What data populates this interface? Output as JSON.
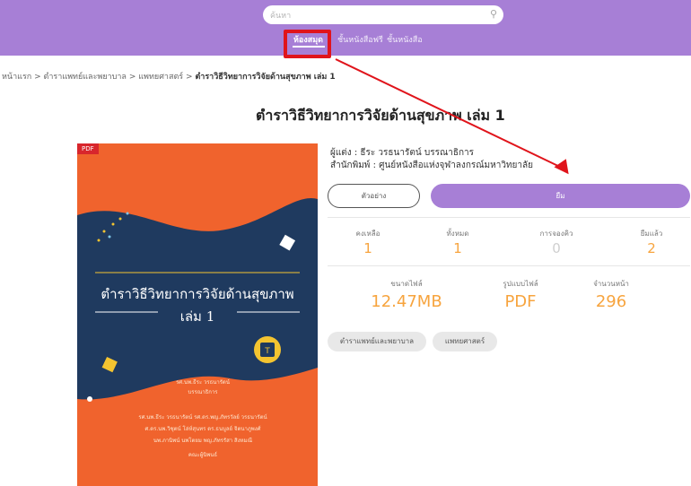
{
  "header": {
    "search_placeholder": "ค้นหา",
    "nav": {
      "library": "ห้องสมุด",
      "free_shelf": "ชั้นหนังสือฟรี",
      "bookshelf": "ชั้นหนังสือ"
    }
  },
  "breadcrumb": {
    "home": "หน้าแรก",
    "sep": ">",
    "cat1": "ตำราแพทย์และพยาบาล",
    "cat2": "แพทยศาสตร์",
    "current": "ตำราวิธีวิทยาการวิจัยด้านสุขภาพ เล่ม 1"
  },
  "book": {
    "title": "ตำราวิธีวิทยาการวิจัยด้านสุขภาพ เล่ม 1",
    "author": "ผู้แต่ง : ธีระ วรธนารัตน์ บรรณาธิการ",
    "publisher": "สำนักพิมพ์ : ศูนย์หนังสือแห่งจุฬาลงกรณ์มหาวิทยาลัย",
    "cover": {
      "badge": "PDF",
      "title_line1": "ตำราวิธีวิทยาการวิจัยด้านสุขภาพ",
      "title_line2": "เล่ม 1",
      "editor_line1": "รศ.นพ.ธีระ วรธนารัตน์",
      "editor_line2": "บรรณาธิการ",
      "authors_line1": "รศ.นพ.ธีระ วรธนารัตน์  รศ.ดร.พญ.ภัทรวัลย์ วรธนารัตน์",
      "authors_line2": "ศ.ดร.นพ.วิชุตน์ โล่ห์สุนทร  ดร.ธนบูลย์ จิตนาภูพงศ์",
      "authors_line3": "นพ.ภานิพน์ นพโตยม  พญ.ภัทรรัสา สิงหมณี",
      "authors_line4": "คณะผู้นิพนธ์"
    }
  },
  "buttons": {
    "sample": "ตัวอย่าง",
    "borrow": "ยืม"
  },
  "stats": [
    {
      "label": "คงเหลือ",
      "value": "1"
    },
    {
      "label": "ทั้งหมด",
      "value": "1"
    },
    {
      "label": "การจองคิว",
      "value": "0"
    },
    {
      "label": "ยืมแล้ว",
      "value": "2"
    }
  ],
  "file_info": [
    {
      "label": "ขนาดไฟล์",
      "value": "12.47MB"
    },
    {
      "label": "รูปแบบไฟล์",
      "value": "PDF"
    },
    {
      "label": "จำนวนหน้า",
      "value": "296"
    }
  ],
  "tags": [
    "ตำราแพทย์และพยาบาล",
    "แพทยศาสตร์"
  ],
  "colors": {
    "brand_purple": "#a77fd6",
    "accent_orange": "#f7a43e",
    "cover_orange": "#f0632d",
    "cover_navy": "#1f3a5f",
    "annotation_red": "#e0141b"
  }
}
